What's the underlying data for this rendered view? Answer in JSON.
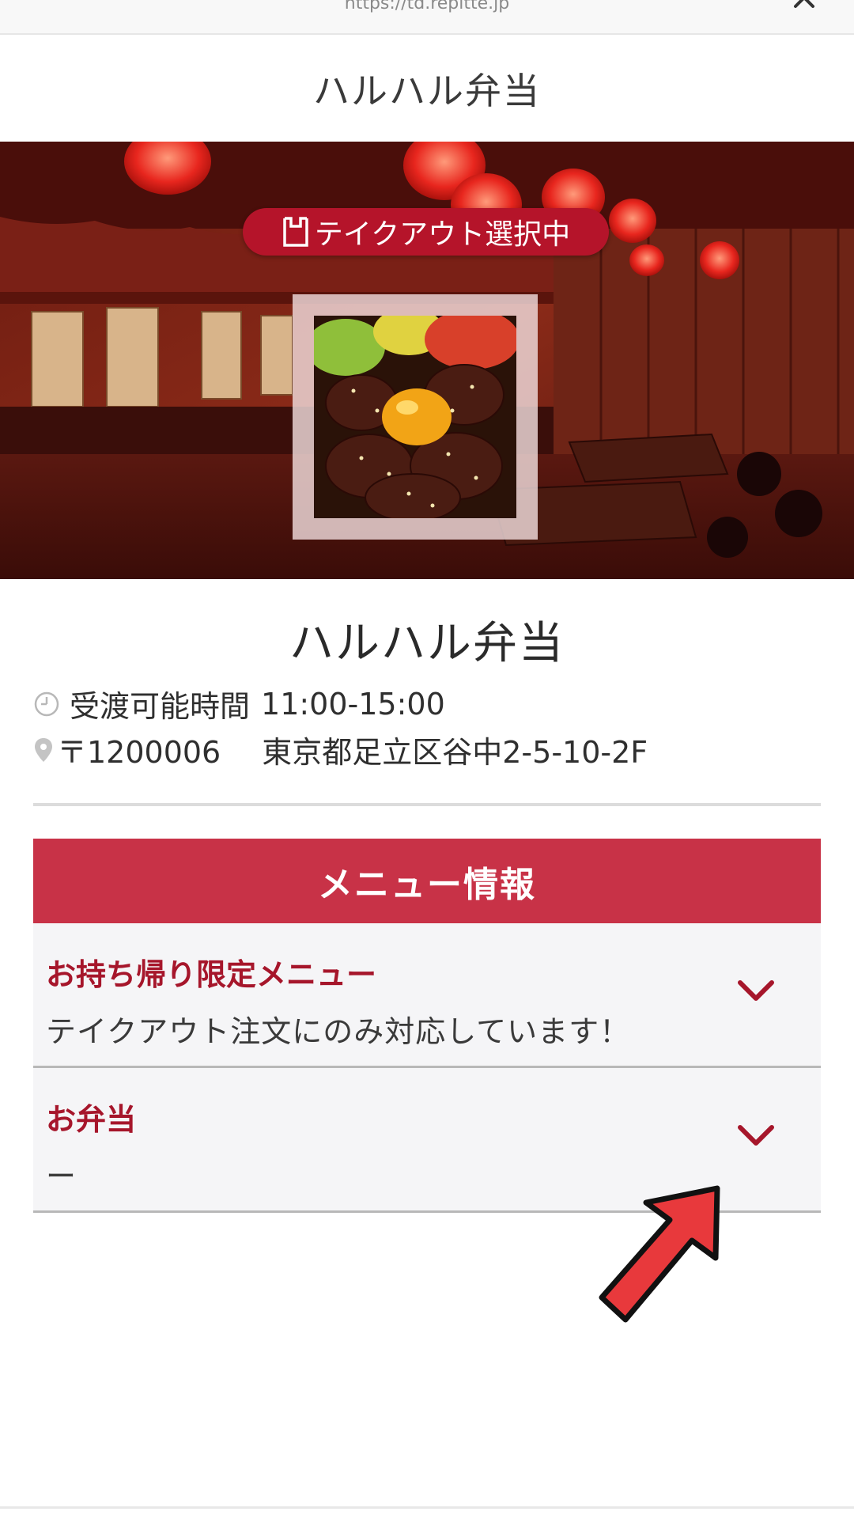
{
  "browser": {
    "url": "https://td.repitte.jp",
    "close_icon": "close-icon"
  },
  "header": {
    "title": "ハルハル弁当"
  },
  "hero": {
    "badge_label": "テイクアウト選択中",
    "badge_icon": "shopping-bag-icon",
    "badge_color": "#b5142a"
  },
  "store": {
    "name": "ハルハル弁当",
    "hours_label": "受渡可能時間",
    "hours_value": "11:00-15:00",
    "hours_icon": "clock-icon",
    "zip": "〒1200006",
    "address": "東京都足立区谷中2-5-10-2F",
    "address_icon": "map-pin-icon"
  },
  "menu": {
    "header_label": "メニュー情報",
    "header_color": "#c83247",
    "items": [
      {
        "title": "お持ち帰り限定メニュー",
        "description": "テイクアウト注文にのみ対応しています！",
        "icon": "chevron-down-icon"
      },
      {
        "title": "お弁当",
        "description": "ー",
        "icon": "chevron-down-icon"
      }
    ]
  },
  "annotation": {
    "icon": "red-arrow-icon",
    "color": "#e8393c"
  }
}
